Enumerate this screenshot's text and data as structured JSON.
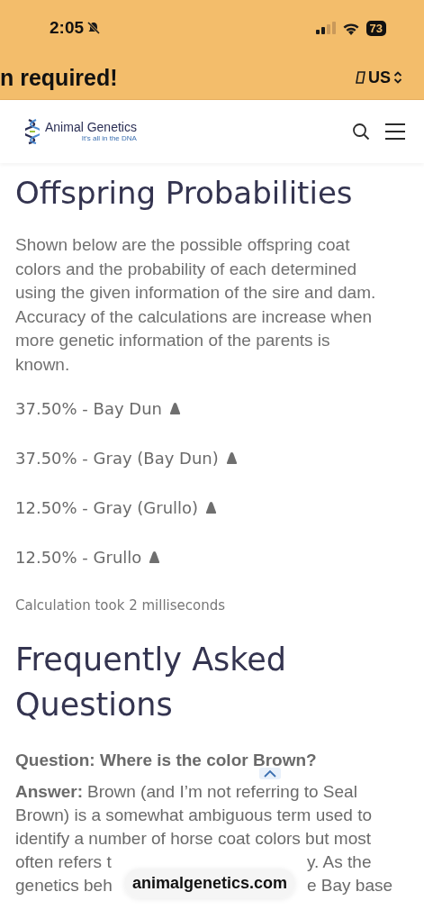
{
  "status_bar": {
    "time": "2:05",
    "battery": "73"
  },
  "banner": {
    "text": "n required!",
    "region": "US"
  },
  "header": {
    "brand": "Animal Genetics",
    "tagline": "It's all in the DNA"
  },
  "offspring": {
    "title": "Offspring Probabilities",
    "intro": "Shown below are the possible offspring coat colors and the probability of each determined using the given information of the sire and dam. Accuracy of the calculations are increase when more genetic information of the parents is known.",
    "results": [
      {
        "text": "37.50% - Bay Dun"
      },
      {
        "text": "37.50% - Gray (Bay Dun)"
      },
      {
        "text": "12.50% - Gray (Grullo)"
      },
      {
        "text": "12.50% - Grullo"
      }
    ],
    "timing": "Calculation took 2 milliseconds"
  },
  "faq": {
    "title": "Frequently Asked Questions",
    "question": "Question: Where is the color Brown?",
    "answer_label": "Answer:",
    "answer_lines": [
      [
        "Brown (and I’m not referring to Seal"
      ],
      [
        "Brown) is a somewhat ambiguous term used to"
      ],
      [
        "identify a number of horse coat colors but most"
      ],
      [
        "often refers t",
        "y. As the"
      ],
      [
        "genetics beh",
        "e Bay base"
      ]
    ]
  },
  "url_pill": "animalgenetics.com"
}
